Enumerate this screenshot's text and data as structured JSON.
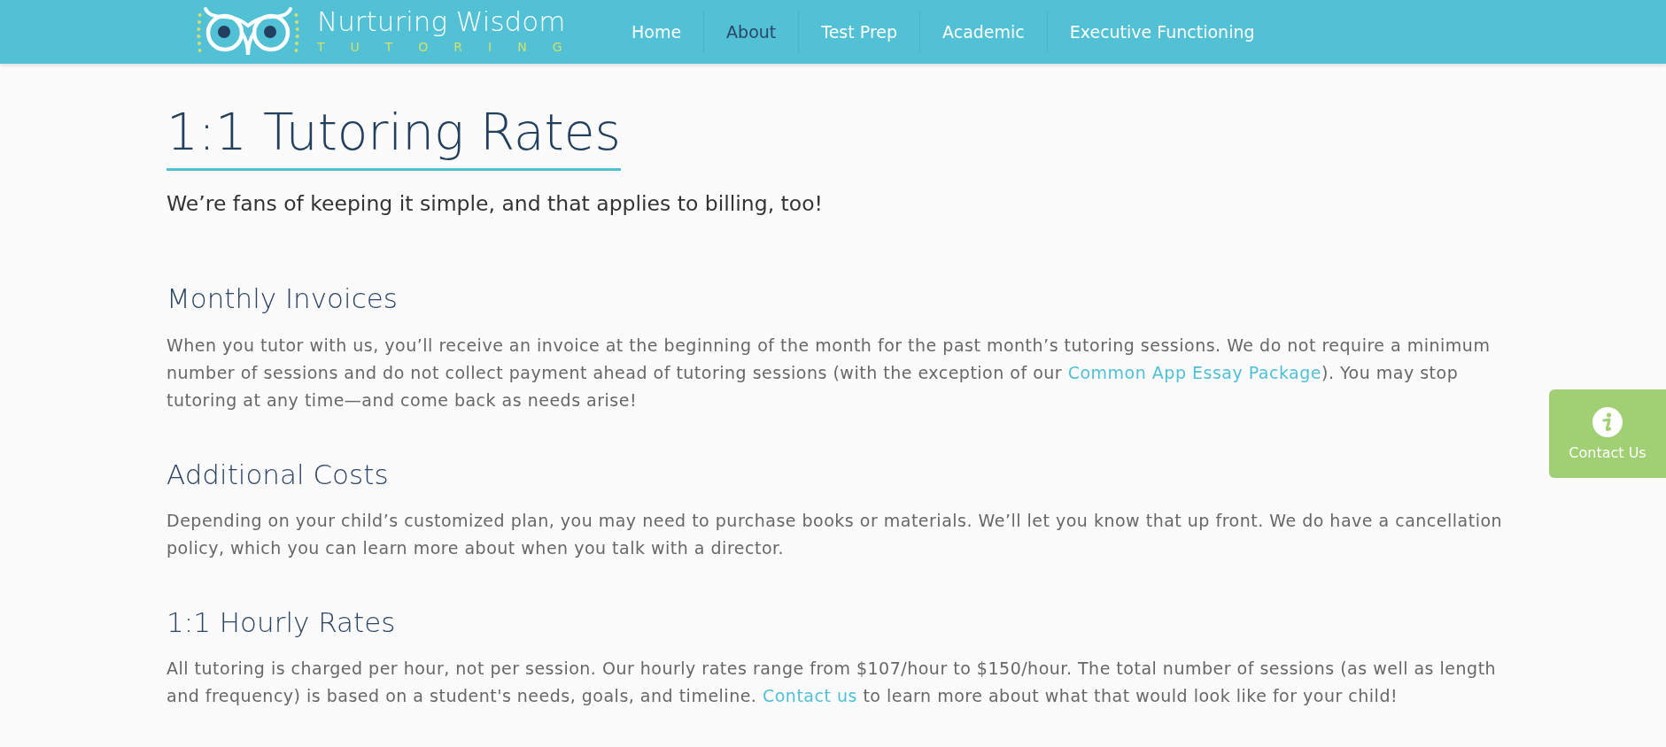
{
  "header": {
    "brand": {
      "name": "Nurturing Wisdom",
      "tagline": "TUTORING"
    },
    "nav": [
      {
        "label": "Home",
        "selected": false
      },
      {
        "label": "About",
        "selected": true
      },
      {
        "label": "Test Prep",
        "selected": false
      },
      {
        "label": "Academic",
        "selected": false
      },
      {
        "label": "Executive Functioning",
        "selected": false
      }
    ]
  },
  "page": {
    "title": "1:1 Tutoring Rates",
    "intro": "We’re fans of keeping it simple, and that applies to billing, too!",
    "sections": [
      {
        "heading": "Monthly Invoices",
        "paragraph": [
          {
            "kind": "text",
            "text": "When you tutor with us, you’ll receive an invoice at the beginning of the month for the past month’s tutoring sessions. We do not require a minimum number of sessions and do not collect payment ahead of tutoring sessions (with the exception of our "
          },
          {
            "kind": "link",
            "text": "Common App Essay Package"
          },
          {
            "kind": "text",
            "text": "). You may stop tutoring at any time—and come back as needs arise!"
          }
        ]
      },
      {
        "heading": "Additional Costs",
        "paragraph": [
          {
            "kind": "text",
            "text": "Depending on your child’s customized plan, you may need to purchase books or materials. We’ll let you know that up front. We do have a cancellation policy, which you can learn more about when you talk with a director."
          }
        ]
      },
      {
        "heading": "1:1 Hourly Rates",
        "paragraph": [
          {
            "kind": "text",
            "text": "All tutoring is charged per hour, not per session. Our hourly rates range from $107/hour to $150/hour. The total number of sessions (as well as length and frequency) is based on a student's needs, goals, and timeline. "
          },
          {
            "kind": "link",
            "text": "Contact us"
          },
          {
            "kind": "text",
            "text": " to learn more about what that would look like for your child!"
          }
        ]
      }
    ]
  },
  "contact_tab": {
    "label": "Contact Us"
  }
}
